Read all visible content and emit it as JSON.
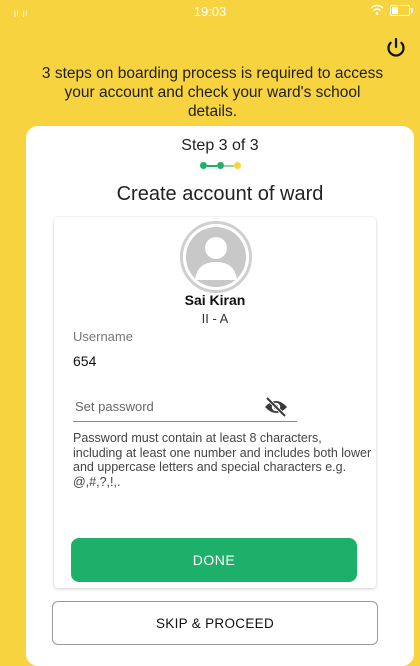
{
  "status_bar": {
    "signal_text": "ᵢₗ ᵢₗ",
    "time": "19:03"
  },
  "header": {
    "intro_text": "3 steps on boarding process is required to access your account and check your ward's school details."
  },
  "step": {
    "label": "Step 3 of 3",
    "current": 3,
    "total": 3,
    "colors": [
      "#1DB06A",
      "#1DB06A",
      "#F7D43F"
    ]
  },
  "card": {
    "title": "Create account of ward"
  },
  "student": {
    "name": "Sai Kiran",
    "class": "II - A"
  },
  "form": {
    "username_label": "Username",
    "username_value": "654",
    "password_placeholder": "Set password",
    "password_hint": "Password must contain at least 8 characters, including at least one number and includes both lower and uppercase letters and special characters e.g. @,#,?,!,.",
    "done_label": "DONE",
    "skip_label": "SKIP & PROCEED"
  },
  "icons": {
    "power": "power-icon",
    "avatar": "user-avatar-icon",
    "eye": "eye-off-icon"
  },
  "colors": {
    "background": "#F7D43F",
    "primary": "#1DB06A"
  }
}
